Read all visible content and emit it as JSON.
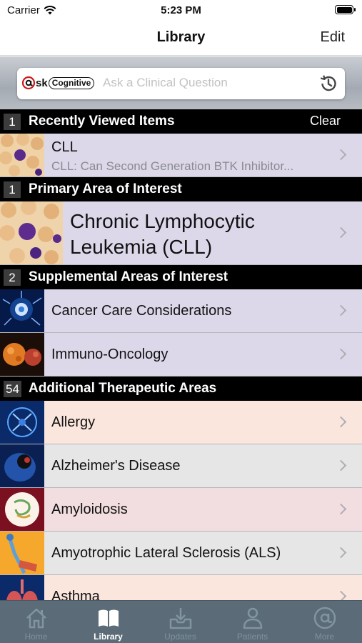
{
  "status_bar": {
    "carrier": "Carrier",
    "time": "5:23 PM"
  },
  "nav": {
    "title": "Library",
    "edit_label": "Edit"
  },
  "search": {
    "logo_ask": "sk",
    "logo_cognitive": "Cognitive",
    "placeholder": "Ask a Clinical Question",
    "history_icon": "history-clock-icon"
  },
  "sections": {
    "recent": {
      "count": "1",
      "title": "Recently Viewed Items",
      "action": "Clear"
    },
    "primary": {
      "count": "1",
      "title": "Primary Area of Interest"
    },
    "supplemental": {
      "count": "2",
      "title": "Supplemental Areas of Interest"
    },
    "additional": {
      "count": "54",
      "title": "Additional Therapeutic Areas"
    }
  },
  "recent_items": [
    {
      "title": "CLL",
      "subtitle": "CLL: Can Second Generation BTK Inhibitor..."
    }
  ],
  "primary_items": [
    {
      "line1": "Chronic Lymphocytic",
      "line2": "Leukemia (CLL)"
    }
  ],
  "supplemental_items": [
    {
      "label": "Cancer Care Considerations"
    },
    {
      "label": "Immuno-Oncology"
    }
  ],
  "additional_items": [
    {
      "label": "Allergy"
    },
    {
      "label": "Alzheimer's Disease"
    },
    {
      "label": "Amyloidosis"
    },
    {
      "label": "Amyotrophic Lateral Sclerosis (ALS)"
    },
    {
      "label": "Asthma"
    }
  ],
  "row_colors": {
    "lavender": "#dcd8ea",
    "peach": "#fbe6de",
    "gray": "#e6e6e6",
    "pink": "#f2dde0"
  },
  "tabs": [
    {
      "label": "Home",
      "icon": "home-icon",
      "active": false
    },
    {
      "label": "Library",
      "icon": "book-icon",
      "active": true
    },
    {
      "label": "Updates",
      "icon": "inbox-download-icon",
      "active": false
    },
    {
      "label": "Patients",
      "icon": "person-icon",
      "active": false
    },
    {
      "label": "More",
      "icon": "at-sign-icon",
      "active": false
    }
  ]
}
